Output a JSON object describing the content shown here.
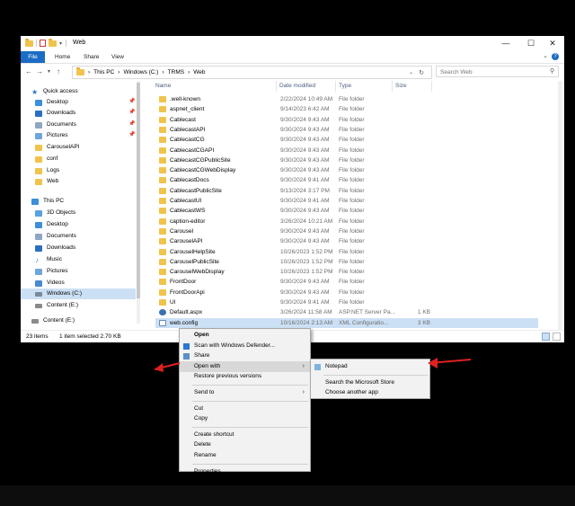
{
  "window": {
    "title": "Web",
    "ribbon_tabs": [
      "File",
      "Home",
      "Share",
      "View"
    ],
    "address": [
      "This PC",
      "Windows (C:)",
      "TRMS",
      "Web"
    ],
    "address_sep": "›",
    "search_placeholder": "Search Web",
    "columns": {
      "name": "Name",
      "date": "Date modified",
      "type": "Type",
      "size": "Size"
    },
    "status": {
      "count": "23 items",
      "selection": "1 item selected  2.70 KB"
    }
  },
  "nav": {
    "items": [
      {
        "label": "Quick access",
        "icon": "star-icon",
        "color": "#2a78d0"
      },
      {
        "label": "Desktop",
        "icon": "desktop-icon",
        "color": "#3c8fd8",
        "pinned": true
      },
      {
        "label": "Downloads",
        "icon": "download-icon",
        "color": "#2a6fc0",
        "pinned": true
      },
      {
        "label": "Documents",
        "icon": "documents-icon",
        "color": "#8ea6c4",
        "pinned": true
      },
      {
        "label": "Pictures",
        "icon": "pictures-icon",
        "color": "#6fa6d8",
        "pinned": true
      },
      {
        "label": "CarouselAPI",
        "icon": "folder-icon",
        "color": "#f0c44c"
      },
      {
        "label": "conf",
        "icon": "folder-icon",
        "color": "#f0c44c"
      },
      {
        "label": "Logs",
        "icon": "folder-icon",
        "color": "#f0c44c"
      },
      {
        "label": "Web",
        "icon": "folder-icon",
        "color": "#f0c44c"
      },
      {
        "label": "This PC",
        "icon": "computer-icon",
        "color": "#3c8fd8"
      },
      {
        "label": "3D Objects",
        "icon": "cube-icon",
        "color": "#5aa2e0"
      },
      {
        "label": "Desktop",
        "icon": "desktop-icon",
        "color": "#3c8fd8"
      },
      {
        "label": "Documents",
        "icon": "documents-icon",
        "color": "#8ea6c4"
      },
      {
        "label": "Downloads",
        "icon": "download-icon",
        "color": "#2a6fc0"
      },
      {
        "label": "Music",
        "icon": "music-icon",
        "color": "#3c8fd8"
      },
      {
        "label": "Pictures",
        "icon": "pictures-icon",
        "color": "#6fa6d8"
      },
      {
        "label": "Videos",
        "icon": "videos-icon",
        "color": "#4a8ad0"
      },
      {
        "label": "Windows (C:)",
        "icon": "drive-icon",
        "color": "#7a8a9a",
        "selected": true
      },
      {
        "label": "Content (E:)",
        "icon": "drive-icon",
        "color": "#8a8a8a"
      },
      {
        "label": "Content (E:)",
        "icon": "drive-icon",
        "color": "#8a8a8a"
      }
    ]
  },
  "files": [
    {
      "name": ".well-known",
      "date": "2/22/2024 10:49 AM",
      "type": "File folder",
      "size": ""
    },
    {
      "name": "aspnet_client",
      "date": "9/14/2023 6:42 AM",
      "type": "File folder",
      "size": ""
    },
    {
      "name": "Cablecast",
      "date": "9/30/2024 9:43 AM",
      "type": "File folder",
      "size": ""
    },
    {
      "name": "CablecastAPI",
      "date": "9/30/2024 9:43 AM",
      "type": "File folder",
      "size": ""
    },
    {
      "name": "CablecastCG",
      "date": "9/30/2024 9:43 AM",
      "type": "File folder",
      "size": ""
    },
    {
      "name": "CablecastCGAPI",
      "date": "9/30/2024 9:43 AM",
      "type": "File folder",
      "size": ""
    },
    {
      "name": "CablecastCGPublicSite",
      "date": "9/30/2024 9:43 AM",
      "type": "File folder",
      "size": ""
    },
    {
      "name": "CablecastCGWebDisplay",
      "date": "9/30/2024 9:43 AM",
      "type": "File folder",
      "size": ""
    },
    {
      "name": "CablecastDocs",
      "date": "9/30/2024 9:41 AM",
      "type": "File folder",
      "size": ""
    },
    {
      "name": "CablecastPublicSite",
      "date": "9/13/2024 3:17 PM",
      "type": "File folder",
      "size": ""
    },
    {
      "name": "CablecastUI",
      "date": "9/30/2024 9:41 AM",
      "type": "File folder",
      "size": ""
    },
    {
      "name": "CablecastWS",
      "date": "9/30/2024 9:43 AM",
      "type": "File folder",
      "size": ""
    },
    {
      "name": "caption-editor",
      "date": "3/26/2024 10:21 AM",
      "type": "File folder",
      "size": ""
    },
    {
      "name": "Carousel",
      "date": "9/30/2024 9:43 AM",
      "type": "File folder",
      "size": ""
    },
    {
      "name": "CarouselAPI",
      "date": "9/30/2024 9:43 AM",
      "type": "File folder",
      "size": ""
    },
    {
      "name": "CarouselHelpSite",
      "date": "10/26/2023 1:52 PM",
      "type": "File folder",
      "size": ""
    },
    {
      "name": "CarouselPublicSite",
      "date": "10/26/2023 1:52 PM",
      "type": "File folder",
      "size": ""
    },
    {
      "name": "CarouselWebDisplay",
      "date": "10/26/2023 1:52 PM",
      "type": "File folder",
      "size": ""
    },
    {
      "name": "FrontDoor",
      "date": "9/30/2024 9:43 AM",
      "type": "File folder",
      "size": ""
    },
    {
      "name": "FrontDoorApi",
      "date": "9/30/2024 9:43 AM",
      "type": "File folder",
      "size": ""
    },
    {
      "name": "UI",
      "date": "9/30/2024 9:41 AM",
      "type": "File folder",
      "size": ""
    },
    {
      "name": "Default.aspx",
      "date": "3/26/2024 11:58 AM",
      "type": "ASP.NET Server Pa...",
      "size": "1 KB",
      "icon": "aspx-file-icon"
    },
    {
      "name": "web.config",
      "date": "10/16/2024 2:13 AM",
      "type": "XML Configuratio...",
      "size": "3 KB",
      "icon": "config-file-icon",
      "selected": true
    }
  ],
  "context_menu": {
    "items": [
      {
        "label": "Open",
        "bold": true
      },
      {
        "label": "Scan with Windows Defender...",
        "icon": "defender-icon"
      },
      {
        "label": "Share",
        "icon": "share-icon"
      },
      {
        "label": "Open with",
        "submenu": true,
        "highlighted": true
      },
      {
        "label": "Restore previous versions"
      },
      {
        "sep": true
      },
      {
        "label": "Send to",
        "submenu": true
      },
      {
        "sep": true
      },
      {
        "label": "Cut"
      },
      {
        "label": "Copy"
      },
      {
        "sep": true
      },
      {
        "label": "Create shortcut"
      },
      {
        "label": "Delete"
      },
      {
        "label": "Rename"
      },
      {
        "sep": true
      },
      {
        "label": "Properties"
      }
    ]
  },
  "open_with_menu": {
    "items": [
      {
        "label": "Notepad",
        "icon": "notepad-icon"
      },
      {
        "sep": true
      },
      {
        "label": "Search the Microsoft Store"
      },
      {
        "label": "Choose another app"
      }
    ]
  },
  "annotation_color": "#e02020"
}
